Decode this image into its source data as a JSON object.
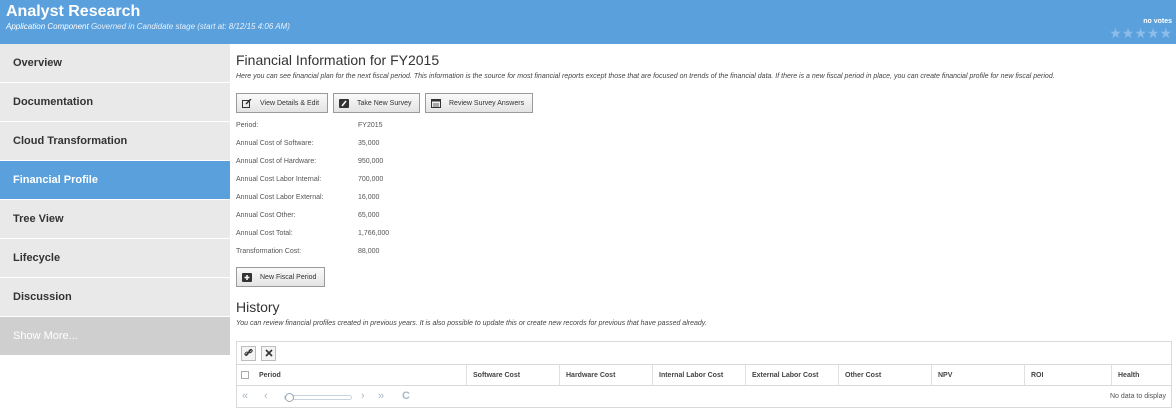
{
  "header": {
    "title": "Analyst Research",
    "component_label": "Application Component",
    "status_text": " Governed in Candidate stage (start at: 8/12/15 4:06 AM)",
    "votes": "no votes",
    "stars": "★★★★★"
  },
  "sidebar": {
    "items": [
      {
        "label": "Overview"
      },
      {
        "label": "Documentation"
      },
      {
        "label": "Cloud Transformation"
      },
      {
        "label": "Financial Profile"
      },
      {
        "label": "Tree View"
      },
      {
        "label": "Lifecycle"
      },
      {
        "label": "Discussion"
      },
      {
        "label": "Show More..."
      }
    ],
    "active_index": 3
  },
  "financial": {
    "title": "Financial Information for FY2015",
    "description": "Here you can see financial plan for the next fiscal period. This information is the source for most financial reports except those that are focused on trends of the financial data. If there is a new fiscal period in place, you can create financial profile for new fiscal period.",
    "buttons": {
      "view": "View Details & Edit",
      "survey": "Take New Survey",
      "review": "Review Survey Answers",
      "new_period": "New Fiscal Period"
    },
    "rows": [
      {
        "label": "Period:",
        "value": "FY2015"
      },
      {
        "label": "Annual Cost of Software:",
        "value": "35,000"
      },
      {
        "label": "Annual Cost of Hardware:",
        "value": "950,000"
      },
      {
        "label": "Annual Cost Labor Internal:",
        "value": "700,000"
      },
      {
        "label": "Annual Cost Labor External:",
        "value": "16,000"
      },
      {
        "label": "Annual Cost Other:",
        "value": "65,000"
      },
      {
        "label": "Annual Cost Total:",
        "value": "1,766,000"
      },
      {
        "label": "Transformation Cost:",
        "value": "88,000"
      }
    ]
  },
  "history": {
    "title": "History",
    "description": "You can review financial profiles created in previous years. It is also possible to update this or create new records for previous that have passed already.",
    "columns": [
      "Period",
      "Software Cost",
      "Hardware Cost",
      "Internal Labor Cost",
      "External Labor Cost",
      "Other Cost",
      "NPV",
      "ROI",
      "Health"
    ],
    "empty_text": "No data to display",
    "pager": {
      "first": "«",
      "prev": "‹",
      "next": "›",
      "last": "»",
      "refresh": "C"
    }
  },
  "colors": {
    "accent": "#5aa0dc",
    "sidebar_bg": "#e9e9e9",
    "more_bg": "#cfcfcf"
  }
}
